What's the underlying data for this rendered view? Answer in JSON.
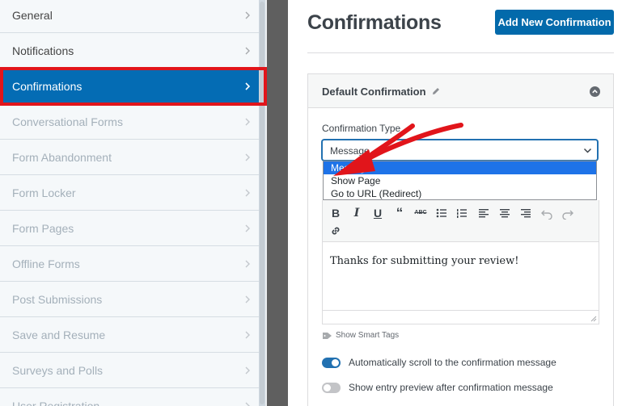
{
  "sidebar": {
    "items": [
      {
        "label": "General",
        "state": "normal"
      },
      {
        "label": "Notifications",
        "state": "normal"
      },
      {
        "label": "Confirmations",
        "state": "active"
      },
      {
        "label": "Conversational Forms",
        "state": "disabled"
      },
      {
        "label": "Form Abandonment",
        "state": "disabled"
      },
      {
        "label": "Form Locker",
        "state": "disabled"
      },
      {
        "label": "Form Pages",
        "state": "disabled"
      },
      {
        "label": "Offline Forms",
        "state": "disabled"
      },
      {
        "label": "Post Submissions",
        "state": "disabled"
      },
      {
        "label": "Save and Resume",
        "state": "disabled"
      },
      {
        "label": "Surveys and Polls",
        "state": "disabled"
      },
      {
        "label": "User Registration",
        "state": "disabled"
      }
    ]
  },
  "main": {
    "title": "Confirmations",
    "add_button_label": "Add New Confirmation",
    "panel": {
      "title": "Default Confirmation",
      "confirmation_type_label": "Confirmation Type",
      "select_value": "Message",
      "dropdown_options": [
        "Message",
        "Show Page",
        "Go to URL (Redirect)"
      ],
      "editor_toolbar": [
        "bold-icon",
        "italic-icon",
        "underline-icon",
        "blockquote-icon",
        "strikethrough-icon",
        "bullet-list-icon",
        "numbered-list-icon",
        "align-left-icon",
        "align-center-icon",
        "align-right-icon",
        "undo-icon",
        "redo-icon",
        "link-icon"
      ],
      "editor_text": "Thanks for submitting your review!",
      "smart_tags_label": "Show Smart Tags",
      "toggles": [
        {
          "label": "Automatically scroll to the confirmation message",
          "on": true
        },
        {
          "label": "Show entry preview after confirmation message",
          "on": false
        }
      ]
    }
  },
  "colors": {
    "accent": "#036aab",
    "active_item": "#046cb4",
    "highlight_outline": "#e1151b",
    "dropdown_selected": "#1e73e8"
  }
}
